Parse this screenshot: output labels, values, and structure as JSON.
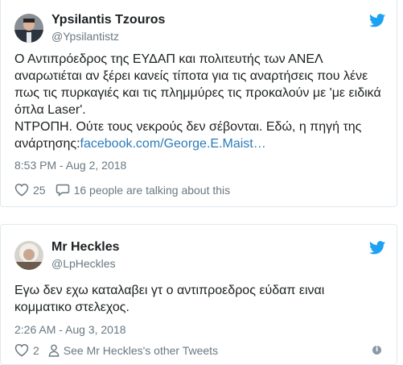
{
  "tweets": [
    {
      "name": "Ypsilantis Tzouros",
      "handle": "@Ypsilantistz",
      "text_lines": [
        "Ο Αντιπρόεδρος της ΕΥΔΑΠ και πολιτευτής των ΑΝΕΛ",
        "αναρωτιέται αν ξέρει κανείς τίποτα για τις αναρτήσεις που λένε",
        "πως τις πυρκαγιές και τις πλημμύρες τις προκαλούν με 'με ειδικά",
        "όπλα Laser'.",
        "ΝΤΡΟΠΗ. Ούτε τους νεκρούς δεν σέβονται. Εδώ, η πηγή της"
      ],
      "text_last_prefix": "ανάρτησης:",
      "link_text": "facebook.com/George.E.Maist…",
      "timestamp": "8:53 PM - Aug 2, 2018",
      "likes": "25",
      "conversation": "16 people are talking about this"
    },
    {
      "name": "Mr Heckles",
      "handle": "@LpHeckles",
      "text_lines": [
        "Εγω δεν εχω καταλαβει γτ ο αντιπροεδρος εύδαπ ειναι",
        "κομματικο στελεχος."
      ],
      "timestamp": "2:26 AM - Aug 3, 2018",
      "likes": "2",
      "profile_link": "See Mr Heckles's other Tweets"
    }
  ],
  "icons": {
    "bird": "twitter-bird-icon",
    "heart": "heart-icon",
    "speech": "speech-bubble-icon",
    "person": "person-icon",
    "info": "info-icon"
  },
  "colors": {
    "twitter_blue": "#1da1f2",
    "link": "#2b7bb9",
    "muted": "#697882",
    "text": "#1c2022",
    "border": "#e1e8ed"
  }
}
